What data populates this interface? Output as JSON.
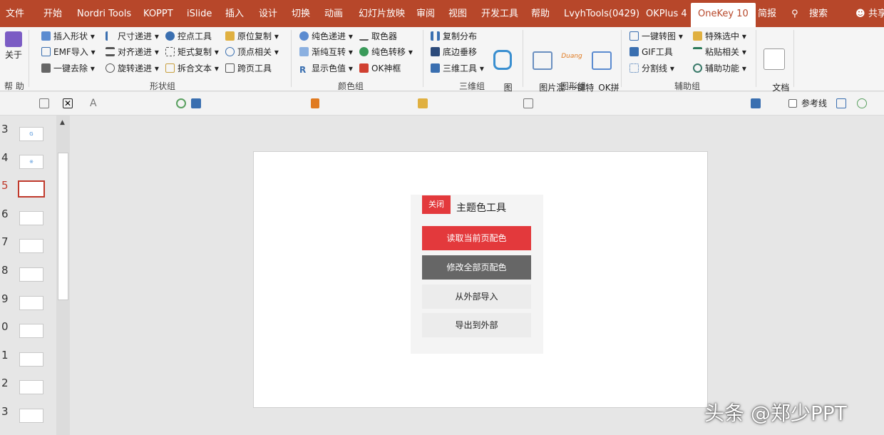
{
  "tabs": [
    "文件",
    "开始",
    "Nordri Tools",
    "KOPPT",
    "iSlide",
    "插入",
    "设计",
    "切换",
    "动画",
    "幻灯片放映",
    "审阅",
    "视图",
    "开发工具",
    "帮助",
    "LvyhTools(0429)",
    "OKPlus 4",
    "OneKey 10",
    "简报",
    "搜索",
    "共享"
  ],
  "ribbon": {
    "help_group": {
      "about_label": "关于",
      "group_label": "帮 助"
    },
    "shape_group": {
      "items": [
        "插入形状 ▾",
        "EMF导入 ▾",
        "一键去除 ▾",
        "尺寸递进 ▾",
        "对齐递进 ▾",
        "旋转递进 ▾",
        "控点工具",
        "矩式复制 ▾",
        "拆合文本 ▾",
        "原位复制 ▾",
        "顶点相关 ▾",
        "跨页工具"
      ],
      "group_label": "形状组"
    },
    "color_group": {
      "items": [
        "纯色递进 ▾",
        "渐纯互转 ▾",
        "显示色值 ▾",
        "取色器",
        "纯色转移 ▾",
        "OK神框"
      ],
      "group_label": "颜色组"
    },
    "threed_group": {
      "items": [
        "复制分布",
        "底边垂移",
        "三维工具 ▾"
      ],
      "library_label": "图\n形库",
      "group_label": "三维组"
    },
    "image_group": {
      "items": [
        "图片混\n合 ▾",
        "一键特\n效 ▾",
        "OK拼\n图 ▾"
      ],
      "duang": "Duang",
      "group_label": "图形组"
    },
    "aux_group": {
      "items": [
        "一键转图 ▾",
        "GIF工具",
        "分割线 ▾",
        "特殊选中 ▾",
        "粘贴相关 ▾",
        "辅助功能 ▾"
      ],
      "group_label": "辅助组"
    },
    "doc_group": {
      "label": "文档\n组 ▾"
    }
  },
  "qat": {
    "reference_line_label": "参考线"
  },
  "slides": [
    {
      "num": "3",
      "thumb_text": "G"
    },
    {
      "num": "4",
      "thumb_text": "※"
    },
    {
      "num": "5",
      "thumb_text": ""
    },
    {
      "num": "6",
      "thumb_text": ""
    },
    {
      "num": "7",
      "thumb_text": ""
    },
    {
      "num": "8",
      "thumb_text": ""
    },
    {
      "num": "9",
      "thumb_text": ""
    },
    {
      "num": "0",
      "thumb_text": ""
    },
    {
      "num": "1",
      "thumb_text": ""
    },
    {
      "num": "2",
      "thumb_text": ""
    },
    {
      "num": "3",
      "thumb_text": ""
    }
  ],
  "panel": {
    "close_label": "关闭",
    "title": "主题色工具",
    "buttons": [
      "读取当前页配色",
      "修改全部页配色",
      "从外部导入",
      "导出到外部"
    ]
  },
  "watermark": "头条 @郑少PPT",
  "colors": {
    "accent": "#b7472a",
    "danger": "#e3393c",
    "dark_button": "#666666",
    "light_button": "#ececec"
  }
}
